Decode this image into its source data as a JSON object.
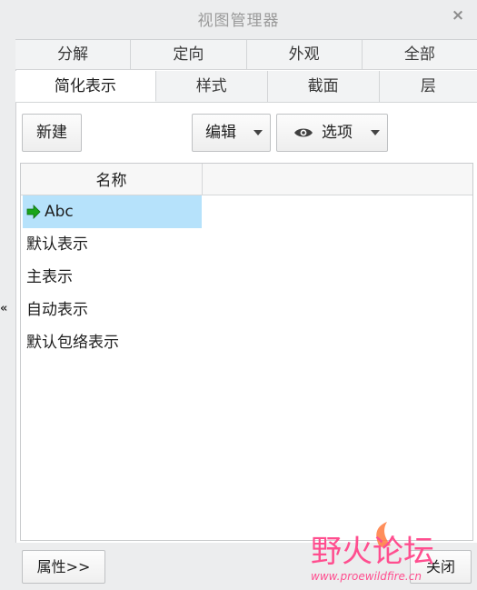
{
  "window": {
    "title": "视图管理器",
    "close": "×",
    "collapse": "«"
  },
  "tabs_row1": [
    "分解",
    "定向",
    "外观",
    "全部"
  ],
  "tabs_row2": [
    "简化表示",
    "样式",
    "截面",
    "层"
  ],
  "active_tab": "简化表示",
  "toolbar": {
    "new_label": "新建",
    "edit_label": "编辑",
    "options_label": "选项"
  },
  "tree": {
    "column_header": "名称",
    "rows": [
      {
        "label": "Abc",
        "active": true
      },
      {
        "label": "默认表示"
      },
      {
        "label": "主表示"
      },
      {
        "label": "自动表示"
      },
      {
        "label": "默认包络表示"
      }
    ]
  },
  "footer": {
    "properties_label": "属性>>",
    "close_label": "关闭"
  },
  "watermark": {
    "brand": "野火论坛",
    "url": "www.proewildfire.cn"
  },
  "colors": {
    "selected_row": "#b6e2fb",
    "arrow": "#1aa51a",
    "watermark": "#ff4e8f"
  }
}
